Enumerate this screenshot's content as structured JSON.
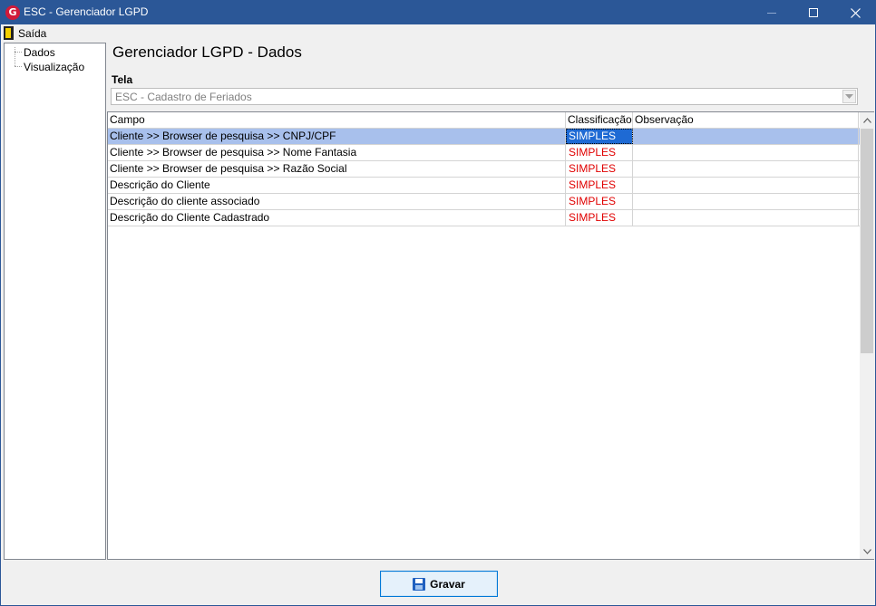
{
  "window": {
    "title": "ESC - Gerenciador LGPD",
    "app_icon_letter": "G",
    "colors": {
      "titlebar": "#2b5797",
      "selected_row": "#a8c0ec",
      "classification_text": "#e00000"
    }
  },
  "menu": {
    "exit_label": "Saída",
    "exit_icon": "door-exit-icon"
  },
  "tree": {
    "items": [
      {
        "label": "Dados"
      },
      {
        "label": "Visualização"
      }
    ]
  },
  "main": {
    "title": "Gerenciador LGPD - Dados",
    "screen_label": "Tela",
    "screen_value": "ESC - Cadastro de Feriados"
  },
  "grid": {
    "columns": [
      "Campo",
      "Classificação",
      "Observação"
    ],
    "rows": [
      {
        "campo": "Cliente >> Browser de pesquisa >> CNPJ/CPF",
        "classificacao": "SIMPLES",
        "observacao": "",
        "selected": true
      },
      {
        "campo": "Cliente >> Browser de pesquisa >> Nome Fantasia",
        "classificacao": "SIMPLES",
        "observacao": ""
      },
      {
        "campo": "Cliente >> Browser de pesquisa >> Razão Social",
        "classificacao": "SIMPLES",
        "observacao": ""
      },
      {
        "campo": "Descrição do Cliente",
        "classificacao": "SIMPLES",
        "observacao": ""
      },
      {
        "campo": "Descrição do cliente associado",
        "classificacao": "SIMPLES",
        "observacao": ""
      },
      {
        "campo": "Descrição do Cliente Cadastrado",
        "classificacao": "SIMPLES",
        "observacao": ""
      }
    ]
  },
  "footer": {
    "save_label": "Gravar",
    "save_icon": "floppy-disk-icon"
  }
}
